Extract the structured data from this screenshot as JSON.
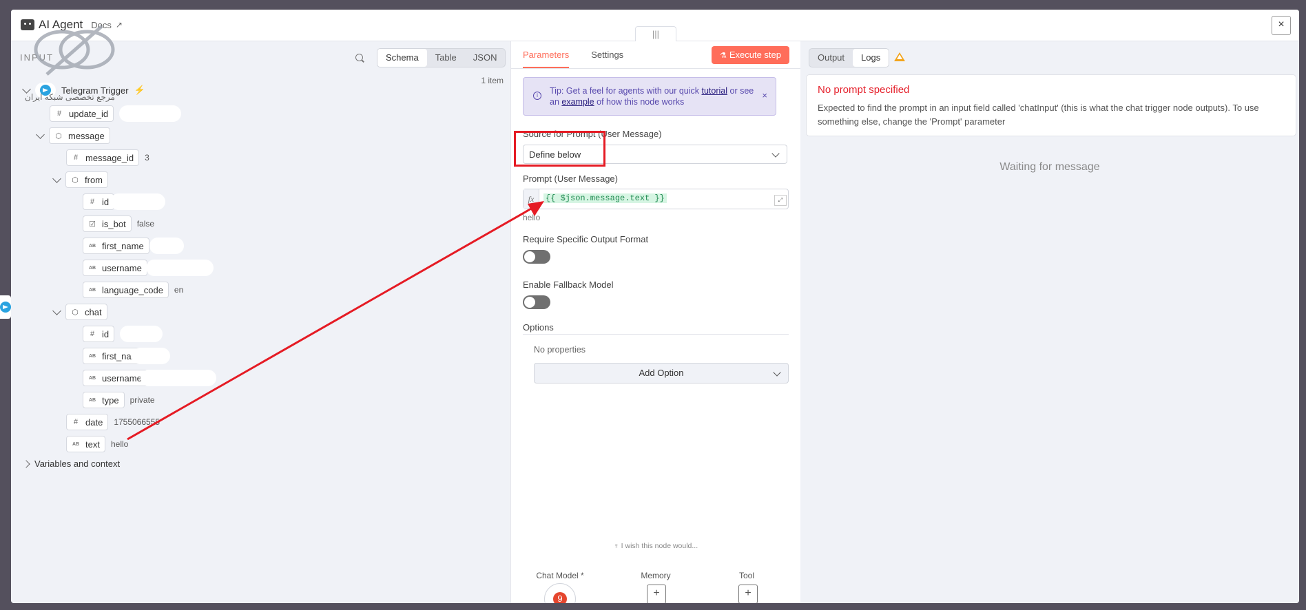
{
  "header": {
    "title": "AI Agent",
    "docs": "Docs",
    "close": "×",
    "drag": "|||"
  },
  "input": {
    "label": "INPUT",
    "views": [
      "Schema",
      "Table",
      "JSON"
    ],
    "item_count": "1 item",
    "watermark_text": "مرجع تخصصی شبکه ایران",
    "tree": {
      "trigger": "Telegram Trigger",
      "update_id": "update_id",
      "message": "message",
      "message_id": "message_id",
      "message_id_val": "3",
      "from": "from",
      "id": "id",
      "is_bot": "is_bot",
      "is_bot_val": "false",
      "first_name": "first_name",
      "username": "username",
      "language_code": "language_code",
      "language_code_val": "en",
      "chat": "chat",
      "chat_id": "id",
      "chat_first_name": "first_name",
      "chat_username": "username",
      "type": "type",
      "type_val": "private",
      "date": "date",
      "date_val": "1755066555",
      "text": "text",
      "text_val": "hello",
      "variables": "Variables and context"
    }
  },
  "params": {
    "tabs": [
      "Parameters",
      "Settings"
    ],
    "execute": "Execute step",
    "tip_a": "Tip: Get a feel for agents with our quick ",
    "tip_link1": "tutorial",
    "tip_b": " or see an ",
    "tip_link2": "example",
    "tip_c": " of how this node works",
    "source_label": "Source for Prompt (User Message)",
    "source_value": "Define below",
    "prompt_label": "Prompt (User Message)",
    "prompt_expr": "{{ $json.message.text }}",
    "prompt_hint": "hello",
    "output_format_label": "Require Specific Output Format",
    "fallback_label": "Enable Fallback Model",
    "options_label": "Options",
    "no_props": "No properties",
    "add_option": "Add Option",
    "wish": "I wish this node would...",
    "chat_model": "Chat Model *",
    "memory": "Memory",
    "tool": "Tool"
  },
  "output": {
    "tabs": [
      "Output",
      "Logs"
    ],
    "error_title": "No prompt specified",
    "error_msg": "Expected to find the prompt in an input field called 'chatInput' (this is what the chat trigger node outputs). To use something else, change the 'Prompt' parameter",
    "waiting": "Waiting for message"
  },
  "colors": {
    "accent": "#ff6d5a",
    "error": "#e5212c",
    "annotation": "#e51b24"
  }
}
